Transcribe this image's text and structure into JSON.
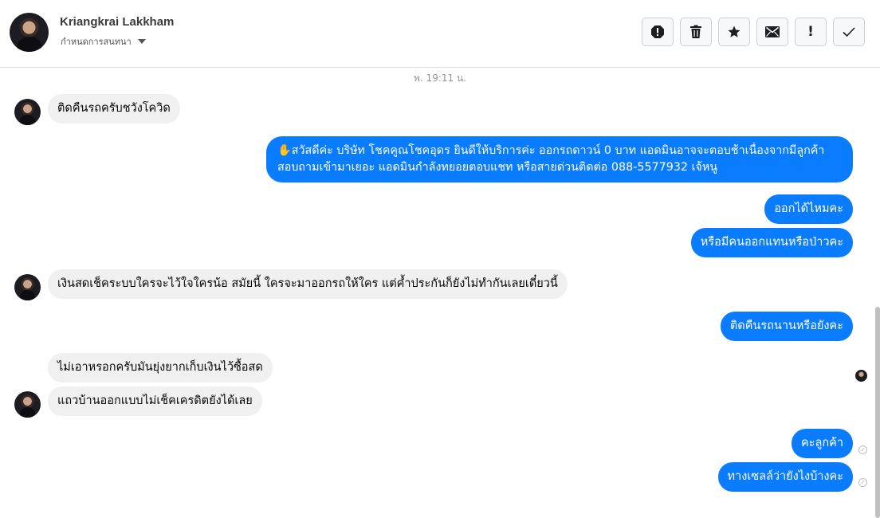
{
  "header": {
    "name": "Kriangkrai Lakkham",
    "subtitle": "กำหนดการสนทนา",
    "toolbar": [
      {
        "name": "report-icon",
        "glyph": "!"
      },
      {
        "name": "trash-icon",
        "glyph": ""
      },
      {
        "name": "star-icon",
        "glyph": ""
      },
      {
        "name": "envelope-icon",
        "glyph": ""
      },
      {
        "name": "exclamation-icon",
        "glyph": "!"
      },
      {
        "name": "check-icon",
        "glyph": ""
      }
    ]
  },
  "timestamp": "พ. 19:11 น.",
  "messages": [
    {
      "dir": "in",
      "text": "ติดคืนรถครับชวังโควิด"
    },
    {
      "dir": "out",
      "text": "✋สวัสดีค่ะ บริษัท โชคคูณโชคอุดร ยินดีให้บริการค่ะ ออกรถดาวน์ 0 บาท แอดมินอาจจะตอบช้าเนื่องจากมีลูกค้าสอบถามเข้ามาเยอะ แอดมินกำลังทยอยตอบแชท หรือสายด่วนติดต่อ 088-5577932 เจ้หนู"
    },
    {
      "dir": "out",
      "text": "ออกได้ไหมคะ"
    },
    {
      "dir": "out",
      "text": "หรือมีคนออกแทนหรือป่าวคะ"
    },
    {
      "dir": "in",
      "text": "เงินสดเช็คระบบใครจะไว้ใจใครน้อ สมัยนี้ ใครจะมาออกรถให้ใคร แต่ค้ำประกันก็ยังไม่ทำกันเลยเดี๋ยวนี้"
    },
    {
      "dir": "out",
      "text": "ติดคืนรถนานหรือยังคะ"
    },
    {
      "dir": "in",
      "text": "ไม่เอาหรอกครับมันยุ่งยากเก็บเงินไว้ซื้อสด"
    },
    {
      "dir": "in",
      "text": "แถวบ้านออกแบบไม่เช็คเครดิตยังได้เลย"
    },
    {
      "dir": "out",
      "text": "คะลูกค้า"
    },
    {
      "dir": "out",
      "text": "ทางเซลล์ว่ายังไงบ้างคะ"
    }
  ],
  "colors": {
    "outgoing": "#0a7cff",
    "incoming": "#f0f0f0"
  }
}
